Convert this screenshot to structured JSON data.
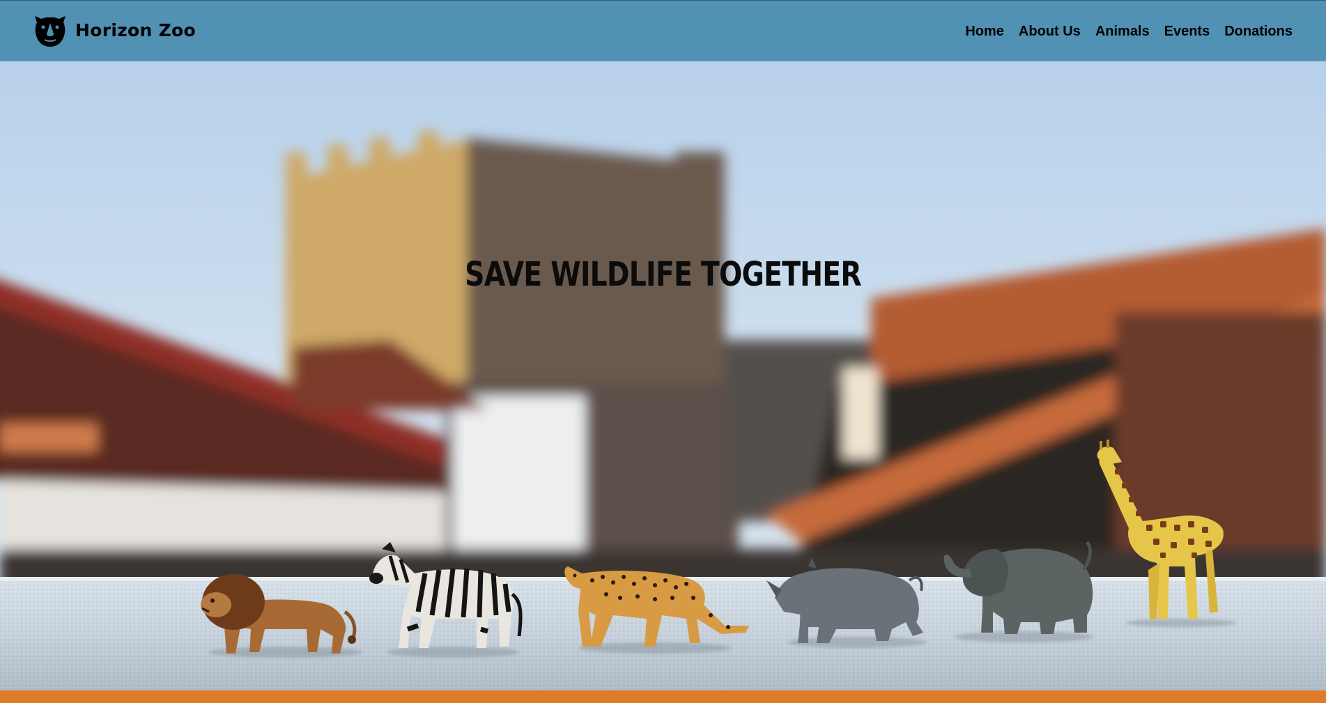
{
  "brand": {
    "name": "Horizon Zoo",
    "logo_icon": "rhino-head-icon"
  },
  "nav": {
    "items": [
      {
        "label": "Home"
      },
      {
        "label": "About Us"
      },
      {
        "label": "Animals"
      },
      {
        "label": "Events"
      },
      {
        "label": "Donations"
      }
    ]
  },
  "hero": {
    "title": "SAVE WILDLIFE TOGETHER",
    "figures": [
      "lion",
      "zebra",
      "cheetah",
      "rhino",
      "elephant",
      "giraffe"
    ]
  },
  "colors": {
    "navbar": "#5191b3",
    "footer_bar": "#e07b2a",
    "text": "#000000"
  }
}
